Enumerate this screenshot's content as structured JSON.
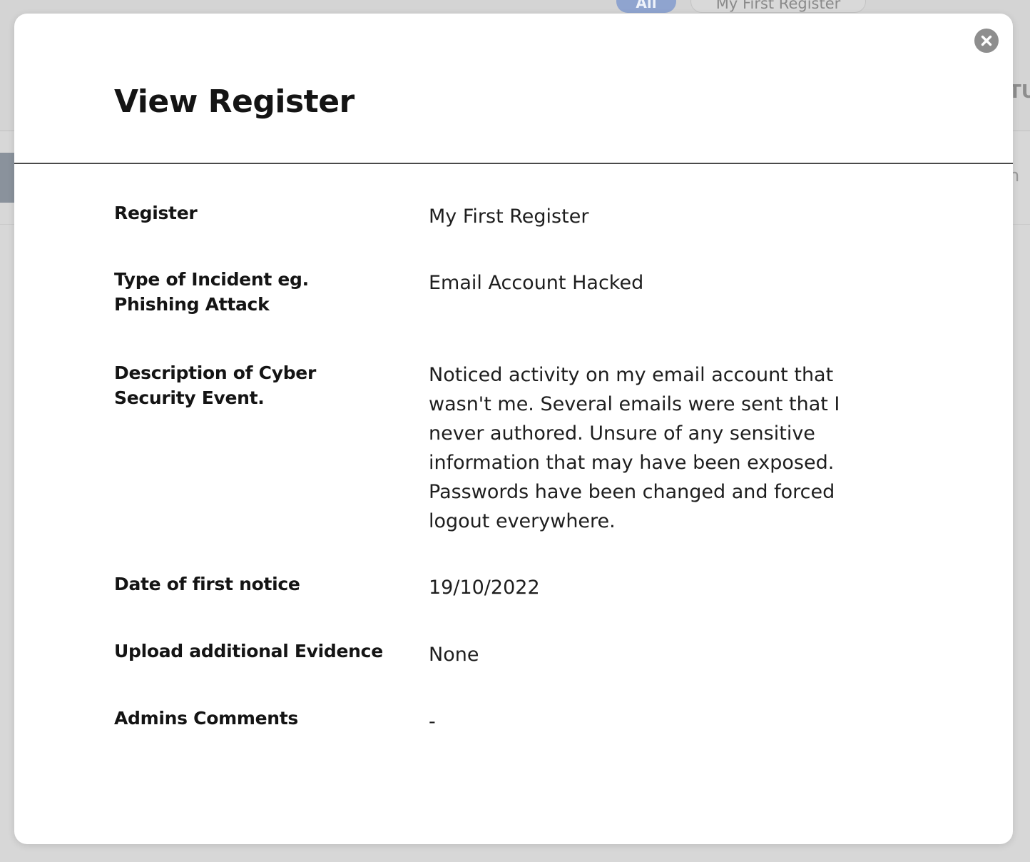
{
  "background": {
    "tabs": [
      "All",
      "My First Register"
    ],
    "column_header_fragment": "TU",
    "row_text_fragment": "n"
  },
  "modal": {
    "title": "View Register",
    "close_icon": "close-icon",
    "fields": [
      {
        "label": "Register",
        "value": "My First Register"
      },
      {
        "label": "Type of Incident eg. Phishing Attack",
        "value": "Email Account Hacked"
      },
      {
        "label": "Description of Cyber Security Event.",
        "value": "Noticed activity on my email account that wasn't me. Several emails were sent that I never authored. Unsure of any sensitive information that may have been exposed. Passwords have been changed and forced logout everywhere."
      },
      {
        "label": "Date of first notice",
        "value": "19/10/2022"
      },
      {
        "label": "Upload additional Evidence",
        "value": "None"
      },
      {
        "label": "Admins Comments",
        "value": "-"
      }
    ]
  },
  "colors": {
    "overlay": "#d7d7d7",
    "modal_bg": "#ffffff",
    "close_button": "#8e8e8e",
    "active_tab": "#8fa4cf"
  }
}
